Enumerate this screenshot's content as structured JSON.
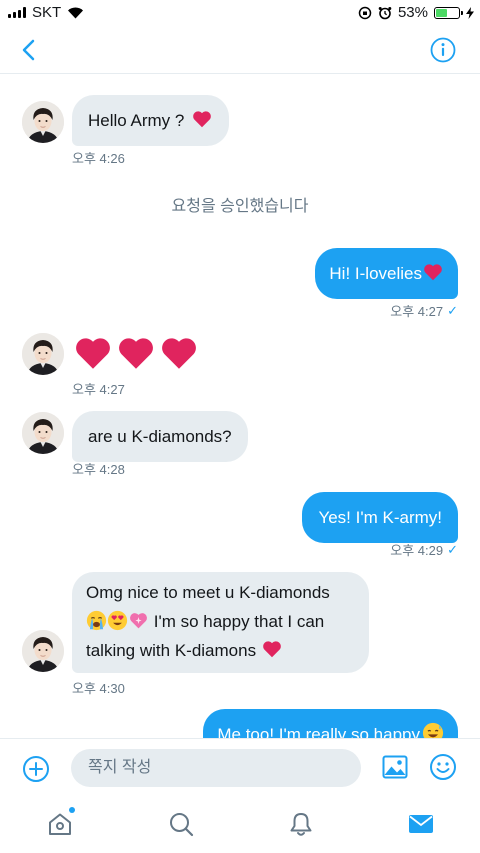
{
  "status_bar": {
    "carrier": "SKT",
    "battery": "53%",
    "battery_level": 0.53
  },
  "nav": {
    "back_icon": "chevron-left-icon",
    "info_icon": "info-circle-icon"
  },
  "messages": {
    "m1": {
      "text": "Hello Army ?",
      "time": "오후 4:26"
    },
    "system": {
      "text": "요청을 승인했습니다"
    },
    "m2": {
      "text": "Hi! I-lovelies",
      "time": "오후 4:27"
    },
    "m3": {
      "time": "오후 4:27"
    },
    "m4": {
      "text": "are u K-diamonds?",
      "time": "오후 4:28"
    },
    "m5": {
      "text": "Yes! I'm K-army!",
      "time": "오후 4:29"
    },
    "m6": {
      "line1": "Omg nice to meet u K-diamonds",
      "line2": "I'm so happy that I can",
      "line3": "talking with K-diamons",
      "time": "오후 4:30"
    },
    "m7": {
      "text": "Me too! I'm really so happy"
    }
  },
  "compose": {
    "placeholder": "쪽지 작성"
  },
  "tabs": [
    "home-icon",
    "search-icon",
    "bell-icon",
    "mail-icon"
  ],
  "colors": {
    "accent": "#1da1f2",
    "bubble_in": "#e6ecf0",
    "heart": "#e0245e"
  }
}
